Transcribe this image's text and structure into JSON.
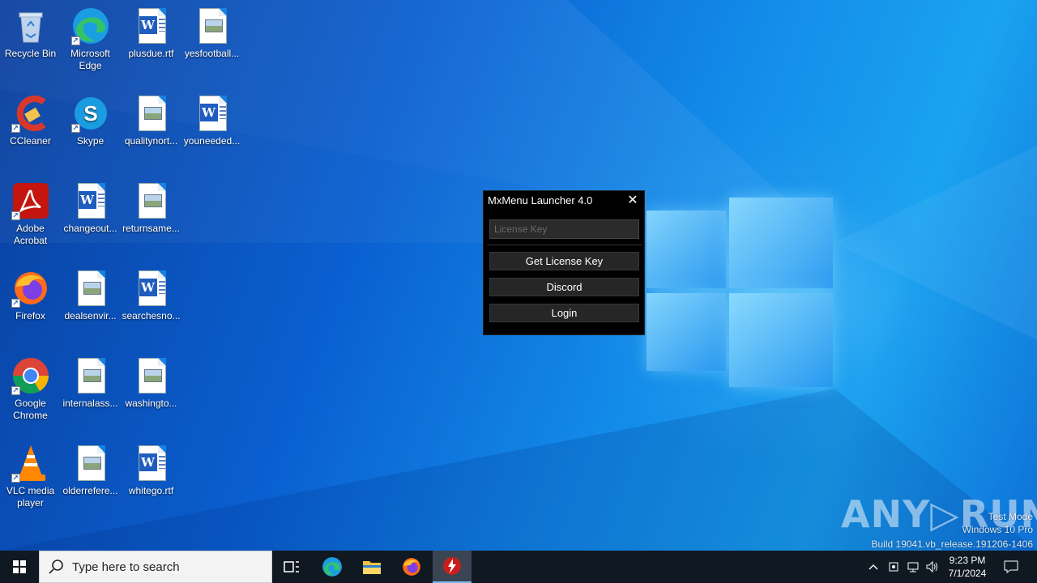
{
  "desktop": {
    "icons": [
      {
        "label": "Recycle Bin"
      },
      {
        "label": "Microsoft Edge"
      },
      {
        "label": "plusdue.rtf"
      },
      {
        "label": "yesfootball..."
      },
      {
        "label": "CCleaner"
      },
      {
        "label": "Skype"
      },
      {
        "label": "qualitynort..."
      },
      {
        "label": "youneeded..."
      },
      {
        "label": "Adobe Acrobat"
      },
      {
        "label": "changeout..."
      },
      {
        "label": "returnsame..."
      },
      {
        "label": "Firefox"
      },
      {
        "label": "dealsenvir..."
      },
      {
        "label": "searchesno..."
      },
      {
        "label": "Google Chrome"
      },
      {
        "label": "internalass..."
      },
      {
        "label": "washingto..."
      },
      {
        "label": "VLC media player"
      },
      {
        "label": "olderrefere..."
      },
      {
        "label": "whitego.rtf"
      }
    ]
  },
  "launcher": {
    "title": "MxMenu Launcher 4.0",
    "close_glyph": "✕",
    "license_placeholder": "License Key",
    "license_value": "",
    "get_license_label": "Get License Key",
    "discord_label": "Discord",
    "login_label": "Login"
  },
  "watermark": {
    "brand": "ANY▷RUN",
    "line1": "Test Mode",
    "line2": "Windows 10 Pro",
    "line3": "Build 19041.vb_release.191206-1406"
  },
  "taskbar": {
    "search_placeholder": "Type here to search",
    "time": "9:23 PM",
    "date": "7/1/2024",
    "apps": [
      "task-view",
      "edge",
      "file-explorer",
      "firefox",
      "mxmenu-launcher"
    ]
  },
  "colors": {
    "accent": "#0a5fd0",
    "taskbar": "#101822",
    "window_bg": "#000000",
    "button_bg": "#262626"
  }
}
